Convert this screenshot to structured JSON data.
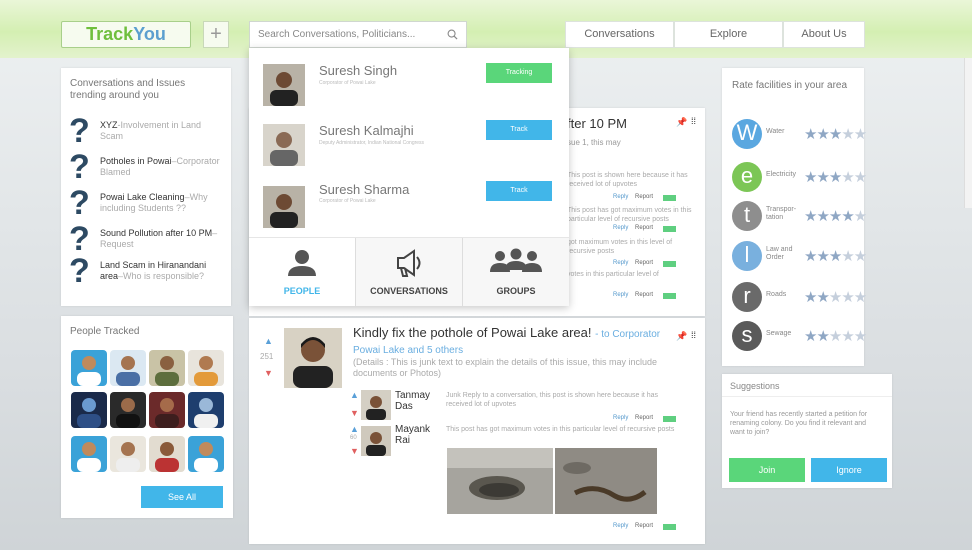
{
  "header": {
    "logo_track": "Track",
    "logo_you": "You",
    "plus": "+",
    "search_placeholder": "Search Conversations, Politicians...",
    "nav": [
      "Conversations",
      "Explore",
      "About Us"
    ]
  },
  "trending": {
    "heading": "Conversations and Issues trending around you",
    "items": [
      {
        "title": "XYZ",
        "sub": "-Involvement in Land Scam"
      },
      {
        "title": "Potholes in Powai",
        "sub": "–Corporator Blamed"
      },
      {
        "title": "Powai Lake Cleaning",
        "sub": "–Why including Students ??"
      },
      {
        "title": "Sound Pollution after 10 PM",
        "sub": "–Request"
      },
      {
        "title": "Land Scam in Hiranandani area",
        "sub": "–Who is responsible?"
      }
    ]
  },
  "people_tracked": {
    "heading": "People Tracked",
    "see_all": "See All"
  },
  "feed": {
    "post1": {
      "title_fragment": "fter 10 PM",
      "sub_fragment": "sue 1, this may",
      "reply1_text": "This post is shown here because it has received lot of upvotes",
      "reply2_text": "This post has got maximum votes in this particular level of recursive posts",
      "reply3_text": "got maximum votes in this level of recursive posts",
      "reply4_text": "votes in this particular level of",
      "reply": "Reply",
      "report": "Report"
    },
    "post2": {
      "vote_count": "251",
      "title": "Kindly fix the pothole of Powai Lake area!",
      "to": "- to Corporator",
      "author": "Powai Lake and 5 others",
      "body": "(Details : This is junk text to explain the details of this issue, this may include documents or Photos)",
      "reply1_name": "Tanmay Das",
      "reply1_text": "Junk Reply to a conversation, this post is shown here because it has received lot of upvotes",
      "reply2_name": "Mayank Rai",
      "reply2_votes": "60",
      "reply2_text": "This post has got maximum votes in this particular level of recursive posts",
      "reply": "Reply",
      "report": "Report"
    }
  },
  "dropdown": {
    "results": [
      {
        "name": "Suresh Singh",
        "desc": "Corporator of Powai Lake",
        "button": "Tracking",
        "color": "#5ad67a"
      },
      {
        "name": "Suresh Kalmajhi",
        "desc": "Deputy Administrator, Indian National Congress",
        "button": "Track",
        "color": "#41b6e9"
      },
      {
        "name": "Suresh Sharma",
        "desc": "Corporator of Powai Lake",
        "button": "Track",
        "color": "#41b6e9"
      }
    ],
    "tabs": [
      {
        "label": "PEOPLE",
        "icon": "person-icon"
      },
      {
        "label": "CONVERSATIONS",
        "icon": "megaphone-icon"
      },
      {
        "label": "GROUPS",
        "icon": "group-icon"
      }
    ]
  },
  "facilities": {
    "heading": "Rate facilities in your area",
    "items": [
      {
        "letter": "W",
        "name": "Water",
        "color": "#5aa7e0",
        "rating": 3
      },
      {
        "letter": "e",
        "name": "Electricity",
        "color": "#7cc656",
        "rating": 3
      },
      {
        "letter": "t",
        "name": "Transportation",
        "name_lines": [
          "Transpor-",
          "tation"
        ],
        "color": "#8e8e8e",
        "rating": 4
      },
      {
        "letter": "l",
        "name": "Law and Order",
        "name_lines": [
          "Law and",
          "Order"
        ],
        "color": "#79b0de",
        "rating": 3
      },
      {
        "letter": "r",
        "name": "Roads",
        "color": "#6a6a6a",
        "rating": 2
      },
      {
        "letter": "s",
        "name": "Sewage",
        "color": "#5a5a5a",
        "rating": 2
      }
    ]
  },
  "suggestions": {
    "heading": "Suggestions",
    "text": "Your friend has recently started a petition for renaming colony. Do you find it relevant and want to join?",
    "join": "Join",
    "ignore": "Ignore",
    "join_color": "#5ad67a",
    "ignore_color": "#41b6e9"
  }
}
